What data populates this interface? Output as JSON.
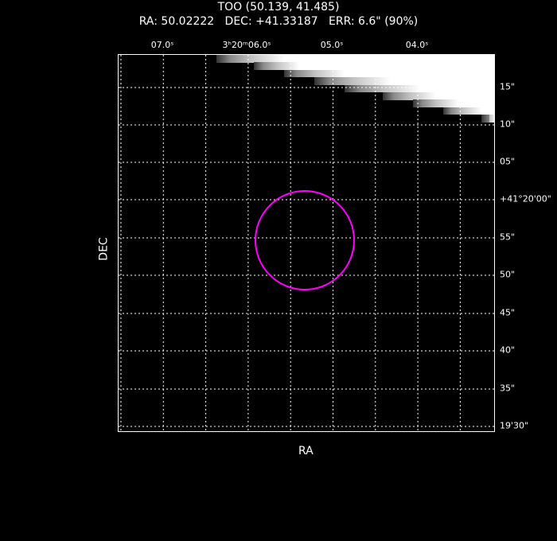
{
  "header": {
    "title": "TOO (50.139, 41.485)",
    "subtitle": "RA: 50.02222   DEC: +41.33187   ERR: 6.6\" (90%)"
  },
  "chart_data": {
    "type": "image",
    "xlabel": "RA",
    "ylabel": "DEC",
    "x_ticks": [
      "07.0ˢ",
      "3ʰ20ᵐ06.0ˢ",
      "05.0ˢ",
      "04.0ˢ"
    ],
    "y_ticks": [
      "15\"",
      "10\"",
      "05\"",
      "+41°20'00\"",
      "55\"",
      "50\"",
      "45\"",
      "40\"",
      "35\"",
      "19'30\""
    ],
    "grid": true,
    "error_circle": {
      "ra": 50.02222,
      "dec": 41.33187,
      "radius_arcsec": 6.6,
      "confidence": "90%",
      "color": "#ff00ff"
    }
  }
}
